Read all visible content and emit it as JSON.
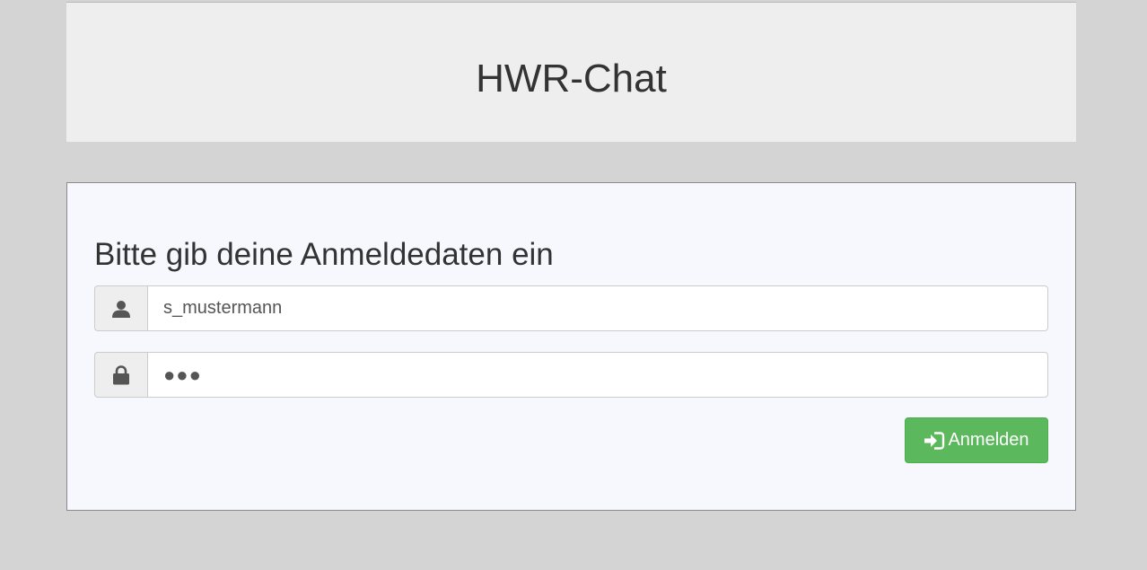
{
  "header": {
    "title": "HWR-Chat"
  },
  "login": {
    "heading": "Bitte gib deine Anmeldedaten ein",
    "username": {
      "icon": "user-icon",
      "value": "s_mustermann"
    },
    "password": {
      "icon": "lock-icon",
      "value": "●●●"
    },
    "submit": {
      "icon": "sign-in-icon",
      "label": "Anmelden"
    }
  },
  "colors": {
    "background": "#d4d4d4",
    "header_bg": "#eeeeee",
    "panel_bg": "#f7f8fd",
    "button_bg": "#5cb85c"
  }
}
